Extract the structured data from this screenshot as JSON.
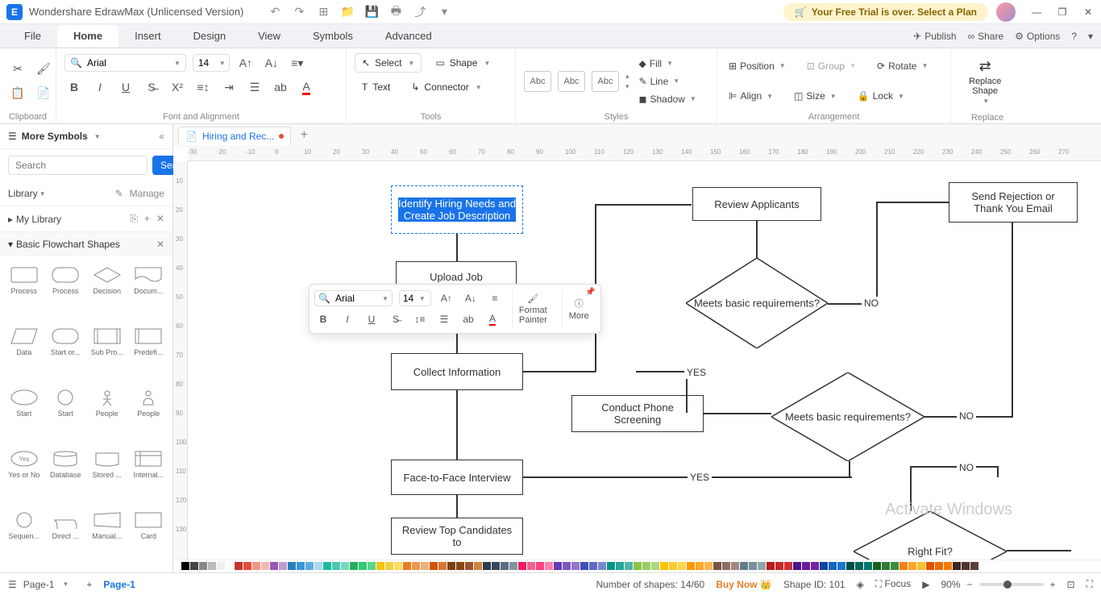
{
  "titlebar": {
    "app_name": "Wondershare EdrawMax (Unlicensed Version)",
    "trial_text": "Your Free Trial is over. Select a Plan"
  },
  "menubar": {
    "items": [
      "File",
      "Home",
      "Insert",
      "Design",
      "View",
      "Symbols",
      "Advanced"
    ],
    "active": "Home",
    "publish": "Publish",
    "share": "Share",
    "options": "Options"
  },
  "ribbon": {
    "clipboard_label": "Clipboard",
    "font_name": "Arial",
    "font_size": "14",
    "font_label": "Font and Alignment",
    "select": "Select",
    "shape": "Shape",
    "text": "Text",
    "connector": "Connector",
    "tools_label": "Tools",
    "style_abc": "Abc",
    "fill": "Fill",
    "line": "Line",
    "shadow": "Shadow",
    "styles_label": "Styles",
    "position": "Position",
    "align": "Align",
    "group": "Group",
    "size": "Size",
    "rotate": "Rotate",
    "lock": "Lock",
    "arrangement_label": "Arrangement",
    "replace_shape": "Replace\nShape",
    "replace_label": "Replace"
  },
  "leftpanel": {
    "more_symbols": "More Symbols",
    "search_placeholder": "Search",
    "search_btn": "Search",
    "library": "Library",
    "manage": "Manage",
    "my_library": "My Library",
    "section": "Basic Flowchart Shapes",
    "shapes": [
      "Process",
      "Process",
      "Decision",
      "Docum...",
      "Data",
      "Start or...",
      "Sub Pro...",
      "Predefi...",
      "Start",
      "Start",
      "People",
      "People",
      "Yes or No",
      "Database",
      "Stored ...",
      "Internal...",
      "Sequen...",
      "Direct ...",
      "Manual...",
      "Card"
    ]
  },
  "document": {
    "tab_name": "Hiring and Rec...",
    "page_name": "Page-1"
  },
  "flowchart": {
    "n1": "Identify Hiring Needs and Create Job Description",
    "n2": "Upload Job",
    "n3": "Collect Information",
    "n4": "Conduct Phone Screening",
    "n5": "Face-to-Face Interview",
    "n6": "Review Top Candidates to",
    "n7": "Review Applicants",
    "n8": "Send Rejection or Thank You Email",
    "d1": "Meets basic requirements?",
    "d2": "Meets basic requirements?",
    "d3": "Right Fit?",
    "yes": "YES",
    "no": "NO"
  },
  "float_toolbar": {
    "font": "Arial",
    "size": "14",
    "format_painter": "Format\nPainter",
    "more": "More"
  },
  "statusbar": {
    "page": "Page-1",
    "shapes_count": "Number of shapes: 14/60",
    "buy_now": "Buy Now",
    "shape_id": "Shape ID: 101",
    "focus": "Focus",
    "zoom": "90%"
  },
  "ruler_marks": [
    " -30",
    "-20",
    "-10",
    "0",
    "10",
    "20",
    "30",
    "40",
    "50",
    "60",
    "70",
    "80",
    "90",
    "100",
    "110",
    "120",
    "130",
    "140",
    "150",
    "160",
    "170",
    "180",
    "190",
    "200",
    "210",
    "220",
    "230",
    "240",
    "250",
    "260",
    "270"
  ],
  "ruler_v_marks": [
    "10",
    "20",
    "30",
    "40",
    "50",
    "60",
    "70",
    "80",
    "90",
    "100",
    "110",
    "120",
    "130"
  ],
  "colors": [
    "#000",
    "#444",
    "#888",
    "#bbb",
    "#eee",
    "#fff",
    "#c0392b",
    "#e74c3c",
    "#f1948a",
    "#f5b7b1",
    "#9b59b6",
    "#c39bd3",
    "#2980b9",
    "#3498db",
    "#5dade2",
    "#aed6f1",
    "#1abc9c",
    "#48c9b0",
    "#76d7c4",
    "#27ae60",
    "#2ecc71",
    "#58d68d",
    "#f1c40f",
    "#f4d03f",
    "#f7dc6f",
    "#e67e22",
    "#eb984e",
    "#f0b27a",
    "#d35400",
    "#dc7633",
    "#784212",
    "#8b4513",
    "#a0522d",
    "#cd853f",
    "#2c3e50",
    "#34495e",
    "#5d6d7e",
    "#85929e",
    "#e91e63",
    "#f06292",
    "#ff4081",
    "#ff80ab",
    "#673ab7",
    "#7e57c2",
    "#9575cd",
    "#3f51b5",
    "#5c6bc0",
    "#7986cb",
    "#009688",
    "#26a69a",
    "#4db6ac",
    "#8bc34a",
    "#9ccc65",
    "#aed581",
    "#ffc107",
    "#ffca28",
    "#ffd54f",
    "#ff9800",
    "#ffa726",
    "#ffb74d",
    "#795548",
    "#8d6e63",
    "#a1887f",
    "#607d8b",
    "#78909c",
    "#90a4ae",
    "#b71c1c",
    "#c62828",
    "#d32f2f",
    "#4a148c",
    "#6a1b9a",
    "#7b1fa2",
    "#0d47a1",
    "#1565c0",
    "#1976d2",
    "#004d40",
    "#00695c",
    "#00796b",
    "#1b5e20",
    "#2e7d32",
    "#388e3c",
    "#f57f17",
    "#f9a825",
    "#fbc02d",
    "#e65100",
    "#ef6c00",
    "#f57c00",
    "#3e2723",
    "#4e342e",
    "#5d4037"
  ]
}
